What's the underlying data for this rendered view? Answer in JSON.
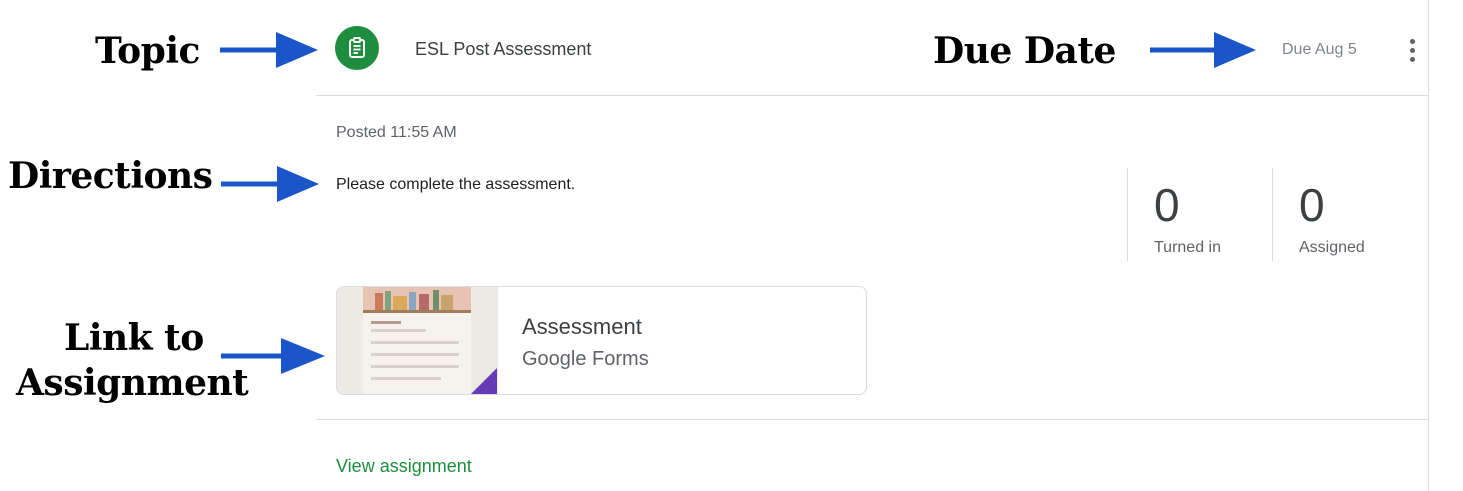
{
  "annotations": {
    "topic": "Topic",
    "due_date": "Due Date",
    "directions": "Directions",
    "link_line1": "Link to",
    "link_line2": "Assignment",
    "arrow_color": "#1a56c9"
  },
  "header": {
    "topic_icon": "assignment-icon",
    "topic_color": "#1e8e3e",
    "title": "ESL Post Assessment",
    "due": "Due Aug 5",
    "menu_icon": "more-vert-icon"
  },
  "body": {
    "posted": "Posted 11:55 AM",
    "directions": "Please complete the assessment."
  },
  "stats": [
    {
      "count": "0",
      "label": "Turned in"
    },
    {
      "count": "0",
      "label": "Assigned"
    }
  ],
  "attachment": {
    "title": "Assessment",
    "subtitle": "Google Forms",
    "thumbnail": "google-forms-preview"
  },
  "footer": {
    "view_link": "View assignment"
  }
}
